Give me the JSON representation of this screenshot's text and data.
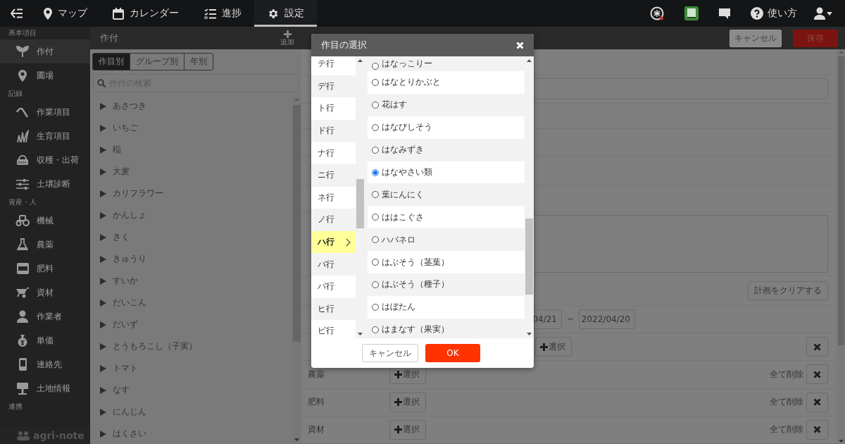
{
  "top_nav": {
    "items": [
      {
        "label": "マップ",
        "selected": false
      },
      {
        "label": "カレンダー",
        "selected": false
      },
      {
        "label": "進捗",
        "selected": false
      },
      {
        "label": "設定",
        "selected": true
      }
    ],
    "help": "使い方"
  },
  "sidebar": {
    "sections": [
      {
        "title": "基本項目",
        "items": [
          {
            "label": "作付",
            "selected": true
          },
          {
            "label": "圃場",
            "selected": false
          }
        ]
      },
      {
        "title": "記録",
        "items": [
          {
            "label": "作業項目",
            "selected": false
          },
          {
            "label": "生育項目",
            "selected": false
          },
          {
            "label": "収穫・出荷",
            "selected": false
          },
          {
            "label": "土壌診断",
            "selected": false
          }
        ]
      },
      {
        "title": "資産・人",
        "items": [
          {
            "label": "機械",
            "selected": false
          },
          {
            "label": "農薬",
            "selected": false
          },
          {
            "label": "肥料",
            "selected": false
          },
          {
            "label": "資材",
            "selected": false
          },
          {
            "label": "作業者",
            "selected": false
          },
          {
            "label": "単価",
            "selected": false
          },
          {
            "label": "連絡先",
            "selected": false
          },
          {
            "label": "土地情報",
            "selected": false
          }
        ]
      },
      {
        "title": "連携"
      }
    ],
    "logo": "agri-note"
  },
  "crop_list": {
    "title": "作付",
    "add_label": "追加",
    "tabs": [
      {
        "label": "作目別",
        "selected": true
      },
      {
        "label": "グループ別",
        "selected": false
      },
      {
        "label": "年別",
        "selected": false
      }
    ],
    "search": {
      "placeholder": "作付の検索"
    },
    "items": [
      "あさつき",
      "いちご",
      "稲",
      "大麦",
      "カリフラワー",
      "かんしょ",
      "きく",
      "きゅうり",
      "すいか",
      "だいこん",
      "だいず",
      "とうもろこし（子実）",
      "トマト",
      "なす",
      "にんじん",
      "はくさい"
    ]
  },
  "detail": {
    "cancel": "キャンセル",
    "save": "保存",
    "clear_plan": "計画をクリアする",
    "date_start": "04/21",
    "date_separator": "～",
    "date_end": "2022/04/20",
    "select_rows": [
      {
        "select": "選択"
      },
      {
        "label": "農薬",
        "select": "選択",
        "clear_all": "全て削除"
      },
      {
        "label": "肥料",
        "select": "選択",
        "clear_all": "全て削除"
      },
      {
        "label": "資材",
        "select": "選択",
        "clear_all": "全て削除"
      }
    ]
  },
  "dialog": {
    "title": "作目の選択",
    "groups": [
      {
        "label": "テ行",
        "selected": false
      },
      {
        "label": "デ行",
        "selected": false
      },
      {
        "label": "ト行",
        "selected": false
      },
      {
        "label": "ド行",
        "selected": false
      },
      {
        "label": "ナ行",
        "selected": false
      },
      {
        "label": "ニ行",
        "selected": false
      },
      {
        "label": "ネ行",
        "selected": false
      },
      {
        "label": "ノ行",
        "selected": false
      },
      {
        "label": "ハ行",
        "selected": true
      },
      {
        "label": "バ行",
        "selected": false
      },
      {
        "label": "パ行",
        "selected": false
      },
      {
        "label": "ヒ行",
        "selected": false
      },
      {
        "label": "ビ行",
        "selected": false
      }
    ],
    "options": [
      {
        "label": "はなっこりー",
        "selected": false
      },
      {
        "label": "はなとりかぶと",
        "selected": false
      },
      {
        "label": "花はす",
        "selected": false
      },
      {
        "label": "はなびしそう",
        "selected": false
      },
      {
        "label": "はなみずき",
        "selected": false
      },
      {
        "label": "はなやさい類",
        "selected": true
      },
      {
        "label": "葉にんにく",
        "selected": false
      },
      {
        "label": "ははこぐさ",
        "selected": false
      },
      {
        "label": "ハバネロ",
        "selected": false
      },
      {
        "label": "はぶそう（茎葉）",
        "selected": false
      },
      {
        "label": "はぶそう（種子）",
        "selected": false
      },
      {
        "label": "はぼたん",
        "selected": false
      },
      {
        "label": "はまなす（果実）",
        "selected": false
      }
    ],
    "cancel": "キャンセル",
    "ok": "OK"
  }
}
